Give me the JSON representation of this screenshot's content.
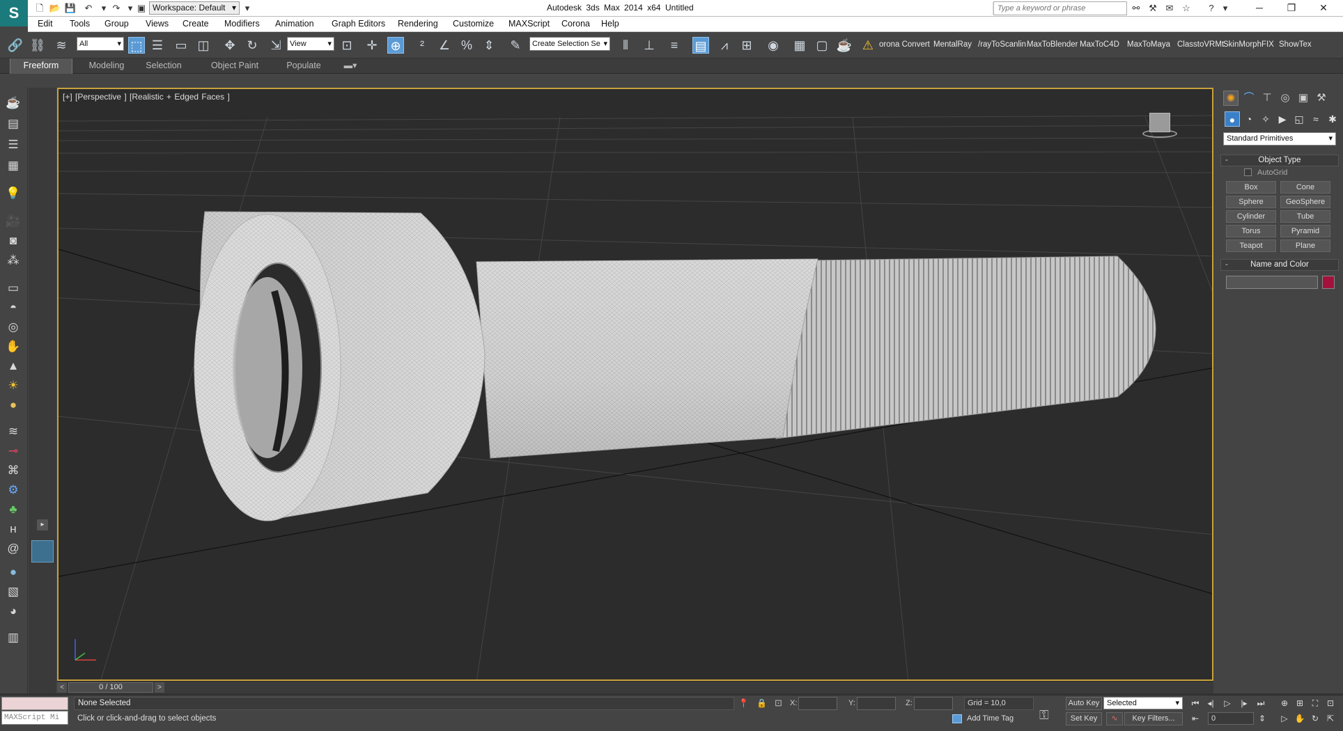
{
  "titlebar": {
    "workspace": "Workspace: Default",
    "app_title": "Autodesk 3ds Max  2014 x64",
    "doc_title": "Untitled",
    "search_placeholder": "Type a keyword or phrase"
  },
  "menus": [
    "Edit",
    "Tools",
    "Group",
    "Views",
    "Create",
    "Modifiers",
    "Animation",
    "Graph Editors",
    "Rendering",
    "Customize",
    "MAXScript",
    "Corona",
    "Help"
  ],
  "toolbar": {
    "selection_filter": "All",
    "ref_coord": "View",
    "named_selection": "Create Selection Se",
    "scripts": [
      "orona Convert",
      "MentalRay",
      "/rayToScanlin",
      "MaxToBlender",
      "MaxToC4D",
      "MaxToMaya",
      "ClasstoVRMt",
      "SkinMorphFIX",
      "ShowTex"
    ]
  },
  "ribbon": {
    "tabs": [
      "Freeform",
      "Modeling",
      "Selection",
      "Object Paint",
      "Populate"
    ],
    "active": "Freeform"
  },
  "viewport": {
    "label": "[+] [Perspective ] [Realistic + Edged Faces ]",
    "active_border_color": "#c8a23a",
    "background": "#2c2c2c"
  },
  "command_panel": {
    "category": "Standard Primitives",
    "object_type_title": "Object Type",
    "autogrid_label": "AutoGrid",
    "buttons": [
      "Box",
      "Cone",
      "Sphere",
      "GeoSphere",
      "Cylinder",
      "Tube",
      "Torus",
      "Pyramid",
      "Teapot",
      "Plane"
    ],
    "name_color_title": "Name and Color",
    "object_color": "#a3123c"
  },
  "timeslider": {
    "frame": "0 / 100",
    "prev": "<",
    "next": ">"
  },
  "status": {
    "listener_text": "MAXScript Mi",
    "selection": "None Selected",
    "prompt": "Click or click-and-drag to select objects",
    "x_label": "X:",
    "y_label": "Y:",
    "z_label": "Z:",
    "grid": "Grid = 10,0",
    "add_time_tag": "Add Time Tag",
    "auto_key": "Auto Key",
    "set_key": "Set Key",
    "key_mode": "Selected",
    "key_filters": "Key Filters...",
    "current_frame": "0"
  }
}
